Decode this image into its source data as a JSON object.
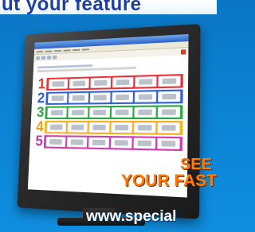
{
  "banner": {
    "headline": "ut your feature",
    "see": "SEE",
    "fast": "YOUR FAST",
    "url": "www.special"
  },
  "screen": {
    "rows": [
      {
        "number": "1",
        "num_color": "#e33127",
        "band_color": "#e8303a"
      },
      {
        "number": "2",
        "num_color": "#2a5fd6",
        "band_color": "#2f5fd8"
      },
      {
        "number": "3",
        "num_color": "#27a54a",
        "band_color": "#29a83f"
      },
      {
        "number": "4",
        "num_color": "#f29a16",
        "band_color": "#f7b21a"
      },
      {
        "number": "5",
        "num_color": "#c53aa8",
        "band_color": "#cf3bb1"
      }
    ],
    "cells_per_row": 6
  },
  "colors": {
    "background": "#0b82d2",
    "headline": "#1f3d9c",
    "accent_orange": "#ff7a00"
  }
}
